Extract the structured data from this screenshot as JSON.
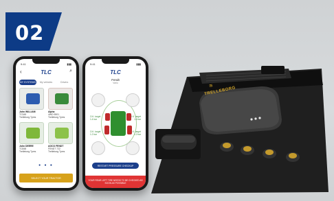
{
  "step_number": "02",
  "phone_left": {
    "status_time": "9:41",
    "logo_text": "TLC",
    "tabs": [
      "MY SYSTEMS",
      "My vehicles",
      "Drivers"
    ],
    "vehicles": [
      {
        "name": "John WILLIAM",
        "line2": "TC345",
        "line3": "Trelleborg Tyres"
      },
      {
        "name": "Alpha",
        "line2": "4WD 5501",
        "line3": "Trelleborg Tyres"
      },
      {
        "name": "John DEERE",
        "line2": "TC848",
        "line3": "Trelleborg Tyres"
      },
      {
        "name": "AGCO FENDT",
        "line2": "FENDT 722",
        "line3": "Trelleborg Tyres"
      }
    ],
    "select_button_label": "SELECT YOUR TRACTOR"
  },
  "phone_right": {
    "status_time": "9:41",
    "logo_text": "TLC",
    "title": "Fendt",
    "subtitle": "Vario",
    "readings": [
      {
        "label": "O.K. target",
        "value": "1.4 bar"
      },
      {
        "label": "O.K. target",
        "value": "1.4 bar"
      },
      {
        "label": "O.K. target",
        "value": "1.2 bar"
      },
      {
        "label": "O.K. target",
        "value": "1.2 bar"
      }
    ],
    "restart_button_label": "RESTART PRESSURE CHECKUP",
    "warning_text_1": "YOUR REAR LEFT TIRE NEEDS TO BE CHECKED AS",
    "warning_text_2": "SOON AS POSSIBLE"
  },
  "device": {
    "brand_text": "TRELLEBORG"
  },
  "colors": {
    "badge": "#0d3b86",
    "brand_gold": "#d2a52a",
    "app_blue": "#1b3f8b",
    "alert_red": "#e03434",
    "ok_green": "#3d8a3d"
  }
}
